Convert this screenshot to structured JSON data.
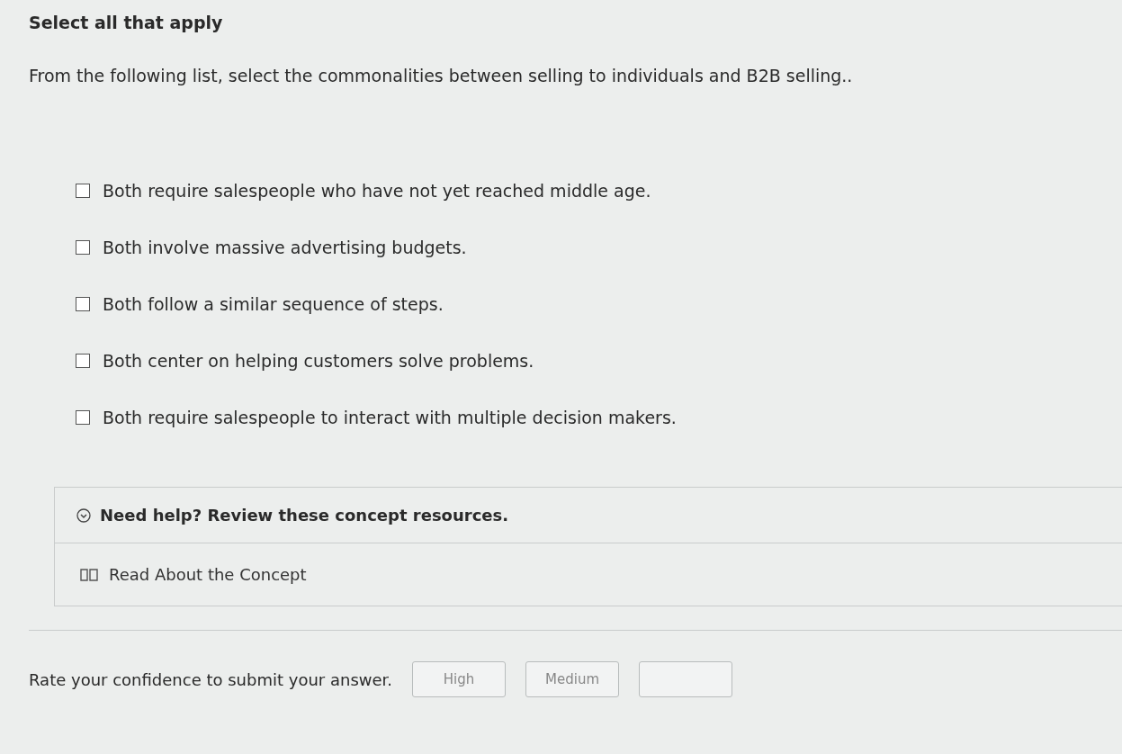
{
  "heading": "Select all that apply",
  "question": "From the following list, select the commonalities between selling to individuals and B2B selling..",
  "options": [
    {
      "label": "Both require salespeople who have not yet reached middle age.",
      "checked": false
    },
    {
      "label": "Both involve massive advertising budgets.",
      "checked": false
    },
    {
      "label": "Both follow a similar sequence of steps.",
      "checked": false
    },
    {
      "label": "Both center on helping customers solve problems.",
      "checked": false
    },
    {
      "label": "Both require salespeople to interact with multiple decision makers.",
      "checked": false
    }
  ],
  "help": {
    "title": "Need help? Review these concept resources.",
    "expanded": true,
    "links": [
      "Read About the Concept"
    ]
  },
  "confidence": {
    "prompt": "Rate your confidence to submit your answer.",
    "buttons": [
      {
        "kind": "labeled",
        "label": "High"
      },
      {
        "kind": "labeled",
        "label": "Medium"
      },
      {
        "kind": "cut_off"
      }
    ]
  }
}
